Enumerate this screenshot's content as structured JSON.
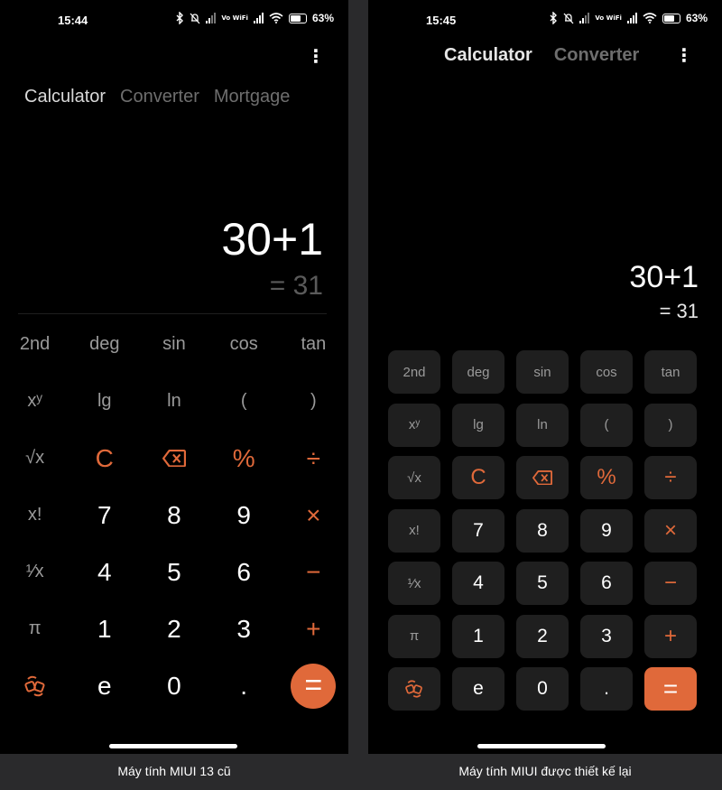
{
  "left": {
    "status": {
      "time": "15:44",
      "volte": "Vo WiFi",
      "battery": "63%"
    },
    "tabs": [
      "Calculator",
      "Converter",
      "Mortgage"
    ],
    "display": {
      "expression": "30+1",
      "result": "= 31"
    },
    "keys": [
      [
        {
          "label": "2nd",
          "type": "fn",
          "name": "second-key"
        },
        {
          "label": "deg",
          "type": "fn",
          "name": "deg-key"
        },
        {
          "label": "sin",
          "type": "fn",
          "name": "sin-key"
        },
        {
          "label": "cos",
          "type": "fn",
          "name": "cos-key"
        },
        {
          "label": "tan",
          "type": "fn",
          "name": "tan-key"
        }
      ],
      [
        {
          "label": "xʸ",
          "type": "fn",
          "name": "power-key"
        },
        {
          "label": "lg",
          "type": "fn",
          "name": "lg-key"
        },
        {
          "label": "ln",
          "type": "fn",
          "name": "ln-key"
        },
        {
          "label": "(",
          "type": "fn",
          "name": "open-paren-key"
        },
        {
          "label": ")",
          "type": "fn",
          "name": "close-paren-key"
        }
      ],
      [
        {
          "label": "√x",
          "type": "fn",
          "name": "sqrt-key"
        },
        {
          "label": "C",
          "type": "op",
          "name": "clear-key"
        },
        {
          "icon": "backspace-icon",
          "type": "op",
          "name": "backspace-key"
        },
        {
          "label": "%",
          "type": "op",
          "name": "percent-key"
        },
        {
          "label": "÷",
          "type": "op",
          "name": "divide-key"
        }
      ],
      [
        {
          "label": "x!",
          "type": "fn",
          "name": "factorial-key"
        },
        {
          "label": "7",
          "type": "num",
          "name": "digit-7-key"
        },
        {
          "label": "8",
          "type": "num",
          "name": "digit-8-key"
        },
        {
          "label": "9",
          "type": "num",
          "name": "digit-9-key"
        },
        {
          "label": "×",
          "type": "op",
          "name": "multiply-key"
        }
      ],
      [
        {
          "label": "¹⁄x",
          "type": "fn",
          "name": "reciprocal-key"
        },
        {
          "label": "4",
          "type": "num",
          "name": "digit-4-key"
        },
        {
          "label": "5",
          "type": "num",
          "name": "digit-5-key"
        },
        {
          "label": "6",
          "type": "num",
          "name": "digit-6-key"
        },
        {
          "label": "−",
          "type": "op",
          "name": "minus-key"
        }
      ],
      [
        {
          "label": "π",
          "type": "fn",
          "name": "pi-key"
        },
        {
          "label": "1",
          "type": "num",
          "name": "digit-1-key"
        },
        {
          "label": "2",
          "type": "num",
          "name": "digit-2-key"
        },
        {
          "label": "3",
          "type": "num",
          "name": "digit-3-key"
        },
        {
          "label": "+",
          "type": "op",
          "name": "plus-key"
        }
      ],
      [
        {
          "icon": "switch-icon",
          "type": "op",
          "name": "switch-mode-key"
        },
        {
          "label": "e",
          "type": "num",
          "name": "e-key"
        },
        {
          "label": "0",
          "type": "num",
          "name": "digit-0-key"
        },
        {
          "label": ".",
          "type": "num",
          "name": "decimal-key"
        },
        {
          "label": "=",
          "type": "eq",
          "name": "equals-key"
        }
      ]
    ],
    "caption": "Máy tính MIUI 13 cũ"
  },
  "right": {
    "status": {
      "time": "15:45",
      "volte": "Vo WiFi",
      "battery": "63%"
    },
    "tabs": [
      "Calculator",
      "Converter"
    ],
    "display": {
      "expression": "30+1",
      "result": "= 31"
    },
    "caption": "Máy tính MIUI được thiết kế lại"
  },
  "colors": {
    "accent": "#e0693a",
    "background": "#000000",
    "key_background": "#1f1f1f"
  }
}
